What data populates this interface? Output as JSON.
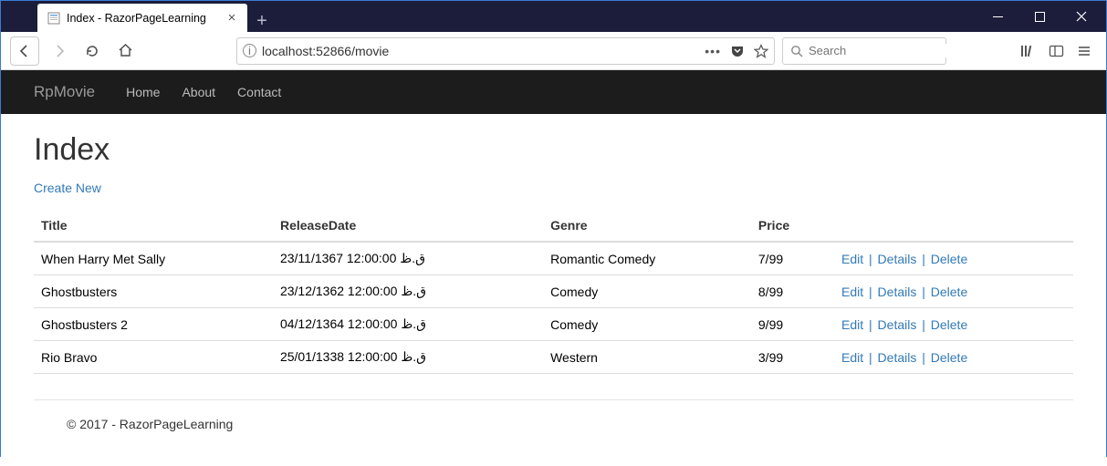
{
  "browser": {
    "tab_title": "Index - RazorPageLearning",
    "url": "localhost:52866/movie",
    "search_placeholder": "Search"
  },
  "navbar": {
    "brand": "RpMovie",
    "links": [
      "Home",
      "About",
      "Contact"
    ]
  },
  "page": {
    "heading": "Index",
    "create_label": "Create New"
  },
  "table": {
    "headers": {
      "title": "Title",
      "release": "ReleaseDate",
      "genre": "Genre",
      "price": "Price"
    },
    "actions": {
      "edit": "Edit",
      "details": "Details",
      "delete": "Delete"
    },
    "rows": [
      {
        "title": "When Harry Met Sally",
        "release": "23/11/1367 12:00:00 ق.ظ",
        "genre": "Romantic Comedy",
        "price": "7/99"
      },
      {
        "title": "Ghostbusters",
        "release": "23/12/1362 12:00:00 ق.ظ",
        "genre": "Comedy",
        "price": "8/99"
      },
      {
        "title": "Ghostbusters 2",
        "release": "04/12/1364 12:00:00 ق.ظ",
        "genre": "Comedy",
        "price": "9/99"
      },
      {
        "title": "Rio Bravo",
        "release": "25/01/1338 12:00:00 ق.ظ",
        "genre": "Western",
        "price": "3/99"
      }
    ]
  },
  "footer": "© 2017 - RazorPageLearning"
}
